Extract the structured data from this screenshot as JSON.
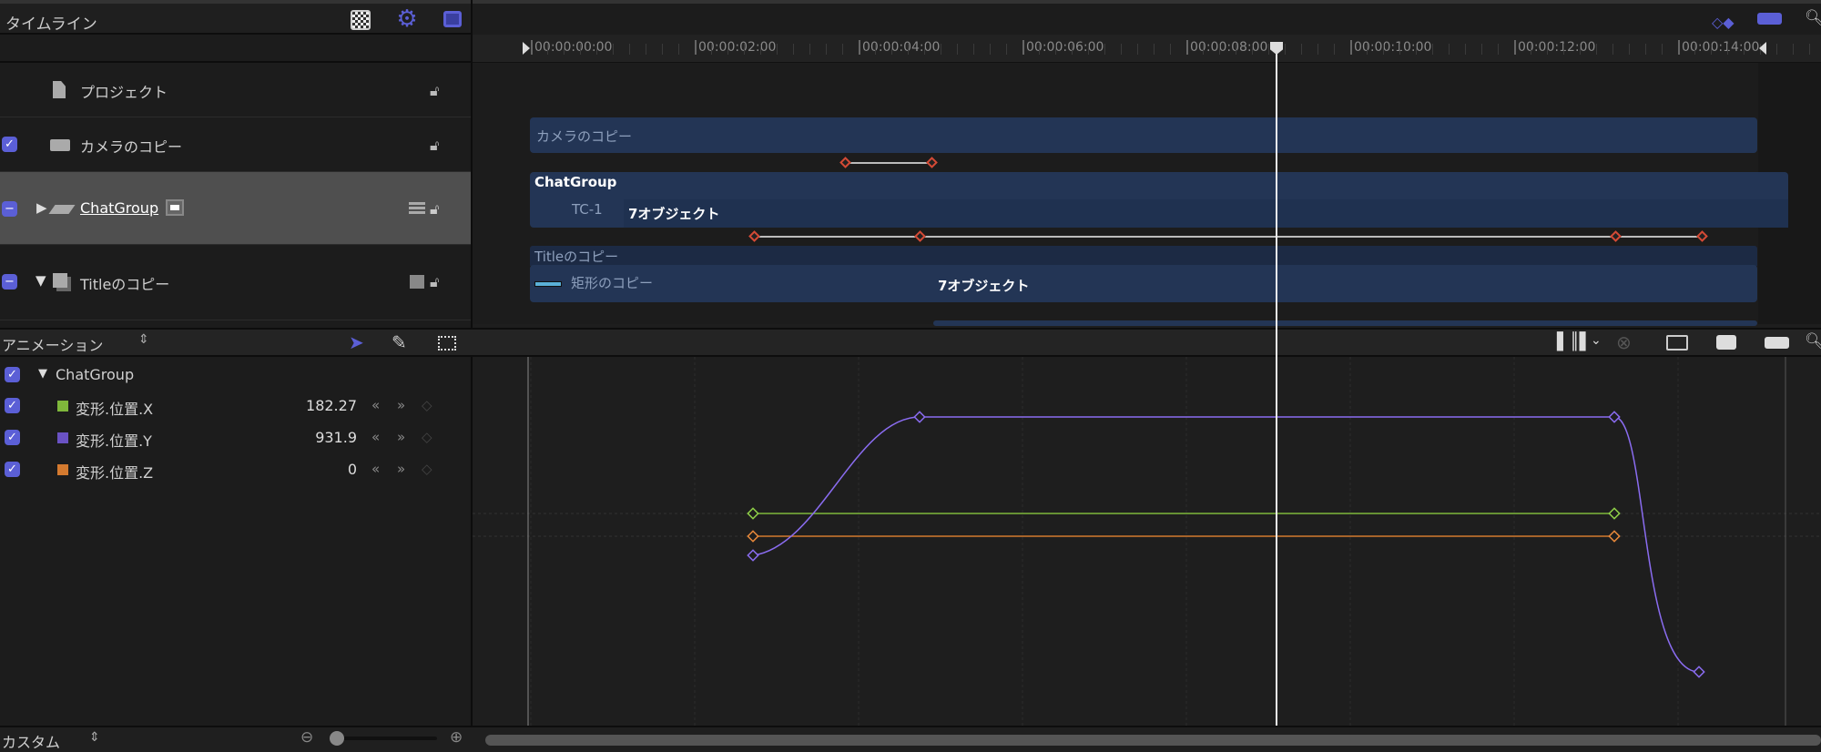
{
  "timeline": {
    "title": "タイムライン",
    "ruler_ticks": [
      "00:00:00:00",
      "00:00:02:00",
      "00:00:04:00",
      "00:00:06:00",
      "00:00:08:00",
      "00:00:10:00",
      "00:00:12:00",
      "00:00:14:00"
    ],
    "playhead_seconds": 9.1,
    "layers": [
      {
        "name": "プロジェクト",
        "icon": "document-icon",
        "checked": null
      },
      {
        "name": "カメラのコピー",
        "icon": "camera-icon",
        "checked": true
      },
      {
        "name": "ChatGroup",
        "icon": "group-icon",
        "checked": "mixed",
        "selected": true
      },
      {
        "name": "Titleのコピー",
        "icon": "layers-icon",
        "checked": "mixed"
      }
    ],
    "tracks": {
      "camera": "カメラのコピー",
      "chatgroup": "ChatGroup",
      "tc": "TC-1",
      "chat_objects": "7オブジェクト",
      "title": "Titleのコピー",
      "rect": "矩形のコピー",
      "title_objects": "7オブジェクト"
    }
  },
  "animation": {
    "menu": "アニメーション",
    "group": "ChatGroup",
    "params": [
      {
        "name": "変形.位置.X",
        "value": "182.27",
        "color": "#7fb83b"
      },
      {
        "name": "変形.位置.Y",
        "value": "931.9",
        "color": "#6a52c4"
      },
      {
        "name": "変形.位置.Z",
        "value": "0",
        "color": "#d47a2f"
      }
    ]
  },
  "bottom": {
    "preset": "カスタム"
  },
  "colors": {
    "accent": "#5b5fd6",
    "track": "#233555",
    "keyframe": "#d44a35"
  }
}
